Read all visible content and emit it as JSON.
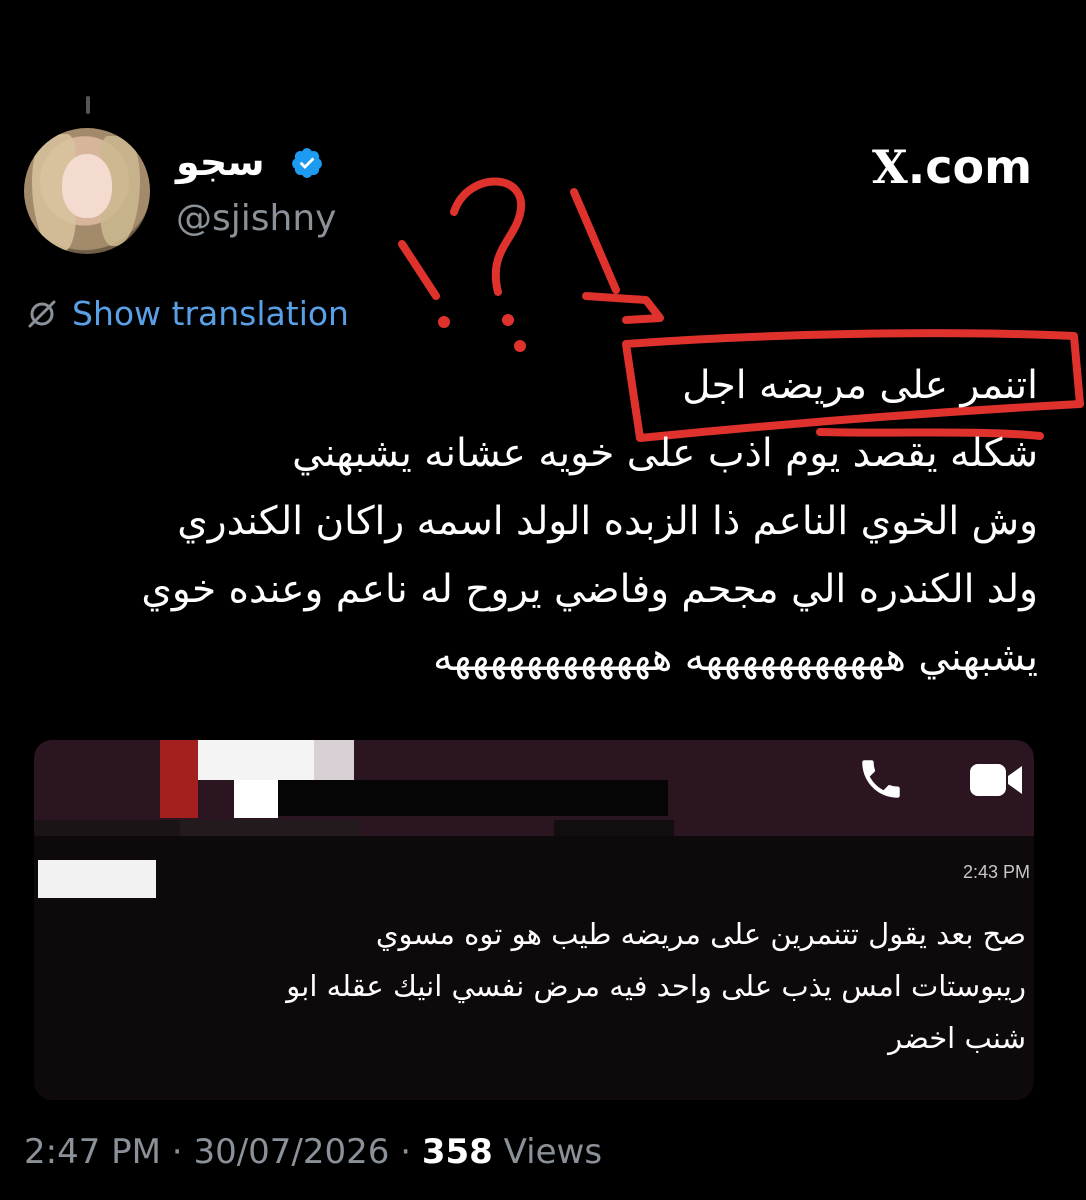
{
  "header": {
    "display_name": "سجو",
    "handle": "@sjishny",
    "site_label": "X.com",
    "site_x": "X",
    "site_rest": ".com"
  },
  "translation": {
    "label": "Show translation"
  },
  "tweet": {
    "lines": [
      "اتنمر على مريضه اجل",
      "شكله يقصد يوم اذب على خويه عشانه يشبهني",
      "وش الخوي الناعم ذا الزبده الولد اسمه راكان الكندري",
      "ولد الكندره الي مجحم وفاضي يروح له ناعم وعنده خوي",
      "يشبهني هههههههههههه ههههههههههههه"
    ]
  },
  "embedded_chat": {
    "time": "2:43 PM",
    "message_lines": [
      "صح بعد يقول تتنمرين على مريضه طيب هو توه مسوي",
      "ريبوستات امس يذب على واحد فيه مرض نفسي انيك عقله ابو",
      "شنب اخضر"
    ]
  },
  "footer": {
    "time": "2:47 PM",
    "date": "30/07/2026",
    "separator": " · ",
    "views_count": "358",
    "views_label": "Views"
  },
  "annotation": {
    "text": "!?!"
  },
  "colors": {
    "background": "#000000",
    "handle": "#8b9198",
    "link": "#5aa0e6",
    "verified": "#1d9bf0",
    "annotation": "#e0322d",
    "chat_header": "#2a1520"
  },
  "icons": [
    "verified-badge-icon",
    "translate-icon",
    "phone-icon",
    "video-camera-icon",
    "avatar"
  ]
}
